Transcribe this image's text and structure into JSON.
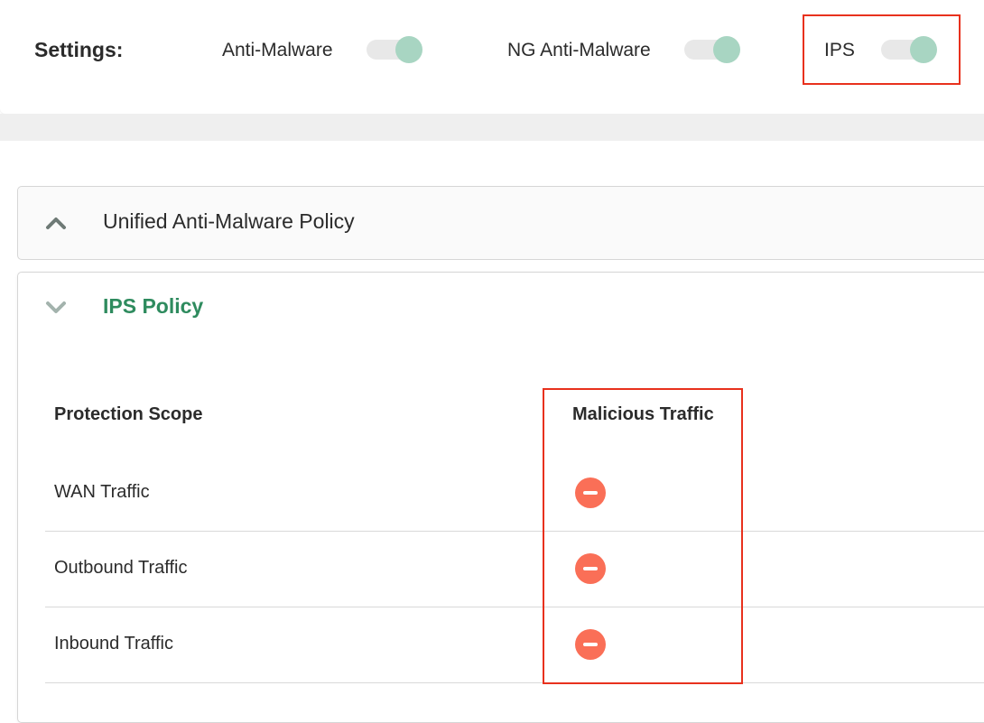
{
  "settings": {
    "title": "Settings:",
    "toggles": [
      {
        "label": "Anti-Malware",
        "state": "on"
      },
      {
        "label": "NG Anti-Malware",
        "state": "on"
      },
      {
        "label": "IPS",
        "state": "on"
      }
    ]
  },
  "panels": {
    "unified": {
      "title": "Unified Anti-Malware Policy",
      "expanded": false
    },
    "ips": {
      "title": "IPS Policy",
      "expanded": true
    }
  },
  "table": {
    "headers": [
      "Protection Scope",
      "Malicious Traffic"
    ],
    "rows": [
      {
        "scope": "WAN Traffic",
        "malicious_traffic": "blocked",
        "icon": "minus-circle-icon"
      },
      {
        "scope": "Outbound Traffic",
        "malicious_traffic": "blocked",
        "icon": "minus-circle-icon"
      },
      {
        "scope": "Inbound Traffic",
        "malicious_traffic": "blocked",
        "icon": "minus-circle-icon"
      }
    ]
  },
  "colors": {
    "toggle_on_knob": "#a8d5c2",
    "toggle_track": "#e8e8e8",
    "accent_green": "#2e8b5e",
    "block_icon": "#fa6f57",
    "highlight_box": "#e8311d"
  }
}
